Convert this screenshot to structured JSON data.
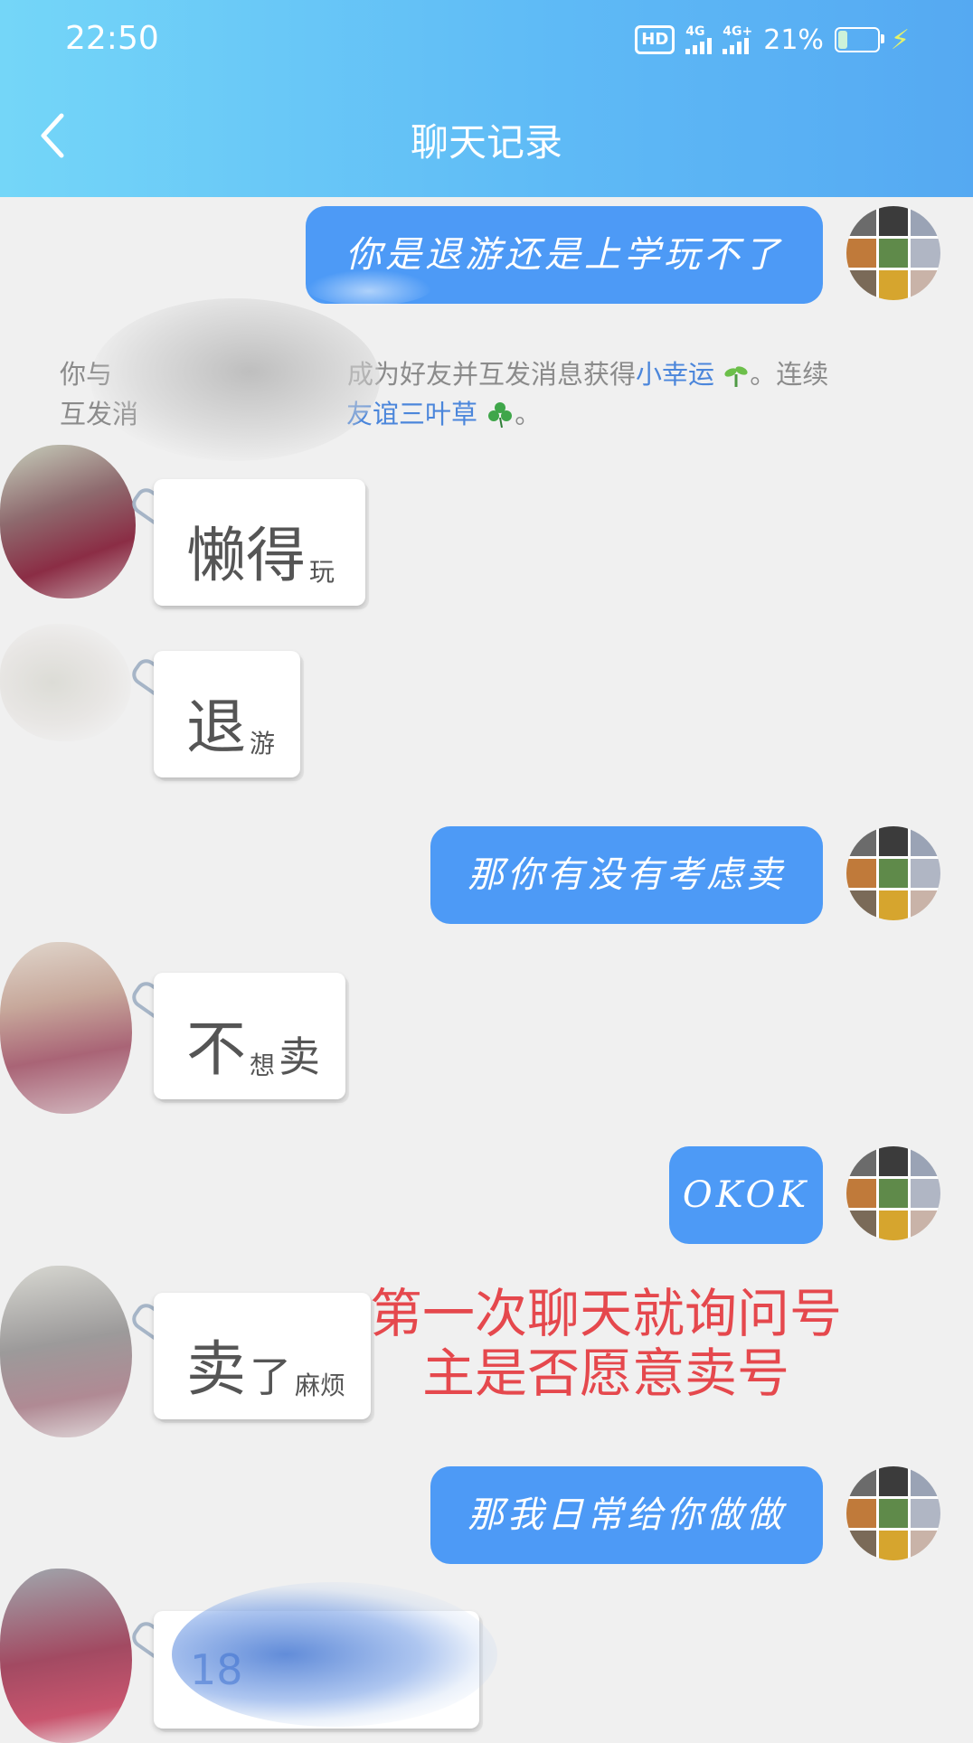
{
  "status_bar": {
    "time": "22:50",
    "hd_badge": "HD",
    "network_1": "4G",
    "network_2": "4G+",
    "battery_percent": "21%",
    "battery_level": 0.21
  },
  "header": {
    "title": "聊天记录"
  },
  "messages": {
    "m1": "你是退游还是上学玩不了",
    "system_part1": "你与",
    "system_part2": "成为好友并互发消息获得",
    "system_link1": "小幸运",
    "system_part3": "。连续",
    "system_part4": "互发消",
    "system_link2": "友谊三叶草",
    "system_part5": "。",
    "m2_big": "懒得",
    "m2_small": "玩",
    "m3_big": "退",
    "m3_small": "游",
    "m4": "那你有没有考虑卖",
    "m5_big": "不",
    "m5_small": "想",
    "m5_mid": "卖",
    "m6": "OKOK",
    "m7_big": "卖",
    "m7_mid": "了",
    "m7_small": "麻烦",
    "m8": "那我日常给你做做",
    "m9_partial": "18"
  },
  "annotation": {
    "line1": "第一次聊天就询问号",
    "line2": "主是否愿意卖号"
  },
  "colors": {
    "header_start": "#74d6f8",
    "header_end": "#55a9f2",
    "out_bubble": "#4d9af6",
    "annotation": "#e5484d",
    "link": "#4b86db"
  },
  "icons": {
    "back": "chevron-left-icon",
    "sprout": "sprout-icon",
    "clover": "clover-icon",
    "paperclip": "paperclip-icon"
  }
}
